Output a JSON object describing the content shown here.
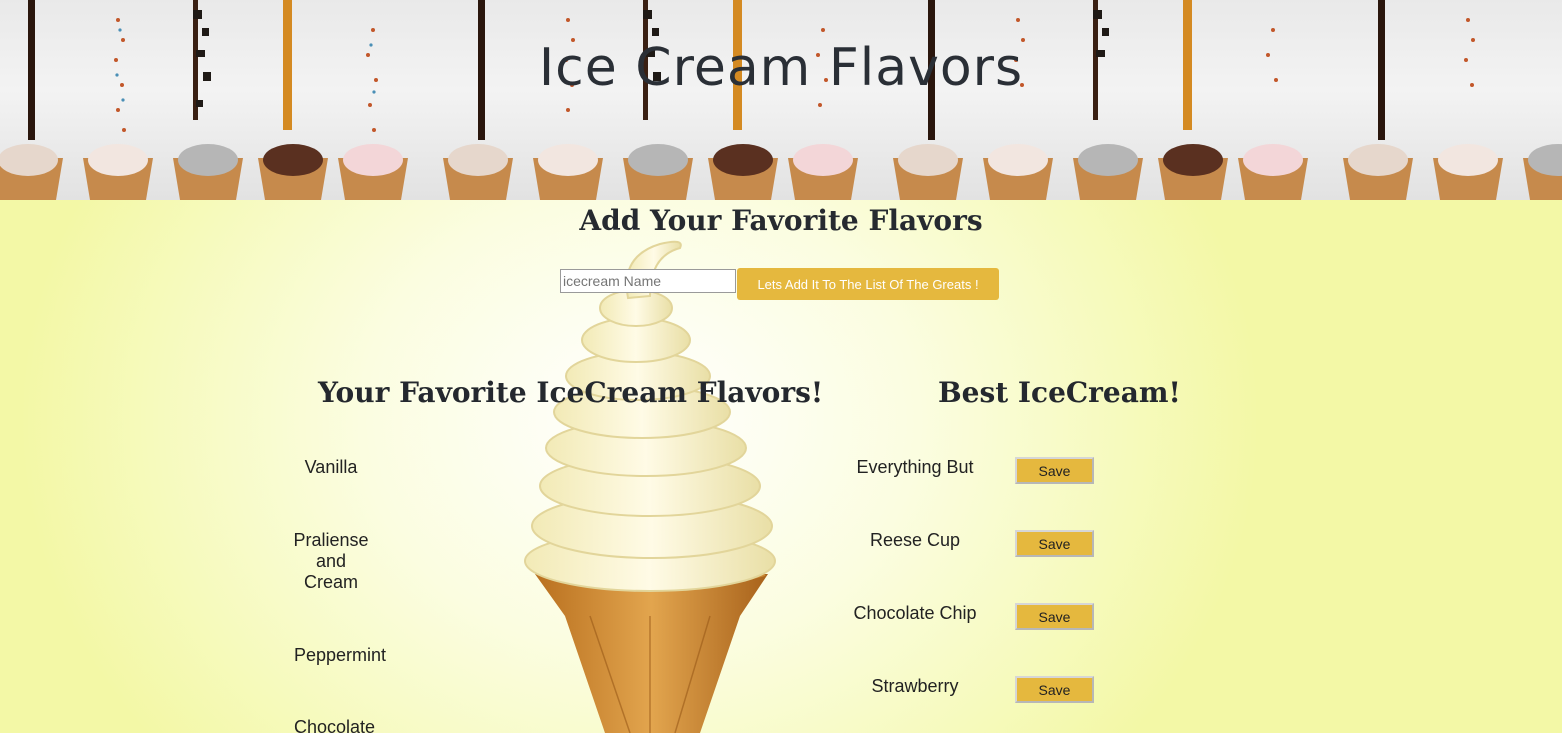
{
  "banner": {
    "title": "Ice Cream Flavors"
  },
  "add_section": {
    "heading": "Add Your Favorite Flavors",
    "input_placeholder": "icecream Name",
    "input_value": "",
    "add_button_label": "Lets Add It To The List Of The Greats !"
  },
  "favorites": {
    "heading": "Your Favorite IceCream Flavors!",
    "items": [
      "Vanilla",
      "Praliense and Cream",
      "Peppermint",
      "Chocolate"
    ]
  },
  "best": {
    "heading": "Best IceCream!",
    "items": [
      {
        "label": "Everything But",
        "button": "Save"
      },
      {
        "label": "Reese Cup",
        "button": "Save"
      },
      {
        "label": "Chocolate Chip",
        "button": "Save"
      },
      {
        "label": "Strawberry",
        "button": "Save"
      }
    ]
  },
  "colors": {
    "accent": "#e5b83e",
    "background": "#f3f8a6",
    "text": "#232323"
  }
}
